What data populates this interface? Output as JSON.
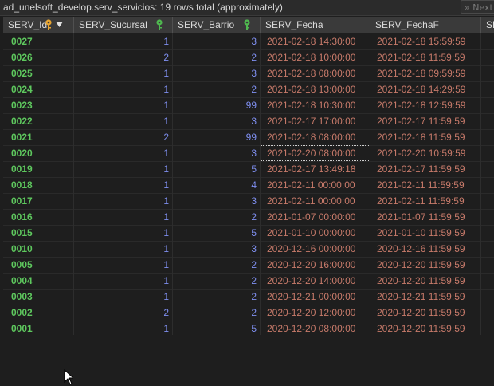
{
  "title": "ad_unelsoft_develop.serv_servicios: 19 rows total (approximately)",
  "next_button": "Next",
  "columns": [
    {
      "label": "SERV_Id"
    },
    {
      "label": "SERV_Sucursal"
    },
    {
      "label": "SERV_Barrio"
    },
    {
      "label": "SERV_Fecha"
    },
    {
      "label": "SERV_FechaF"
    },
    {
      "label": "SE"
    }
  ],
  "rows": [
    {
      "id": "0027",
      "suc": "1",
      "bar": "3",
      "fecha": "2021-02-18 14:30:00",
      "fechaf": "2021-02-18 15:59:59"
    },
    {
      "id": "0026",
      "suc": "2",
      "bar": "2",
      "fecha": "2021-02-18 10:00:00",
      "fechaf": "2021-02-18 11:59:59"
    },
    {
      "id": "0025",
      "suc": "1",
      "bar": "3",
      "fecha": "2021-02-18 08:00:00",
      "fechaf": "2021-02-18 09:59:59"
    },
    {
      "id": "0024",
      "suc": "1",
      "bar": "2",
      "fecha": "2021-02-18 13:00:00",
      "fechaf": "2021-02-18 14:29:59"
    },
    {
      "id": "0023",
      "suc": "1",
      "bar": "99",
      "fecha": "2021-02-18 10:30:00",
      "fechaf": "2021-02-18 12:59:59"
    },
    {
      "id": "0022",
      "suc": "1",
      "bar": "3",
      "fecha": "2021-02-17 17:00:00",
      "fechaf": "2021-02-17 11:59:59"
    },
    {
      "id": "0021",
      "suc": "2",
      "bar": "99",
      "fecha": "2021-02-18 08:00:00",
      "fechaf": "2021-02-18 11:59:59"
    },
    {
      "id": "0020",
      "suc": "1",
      "bar": "3",
      "fecha": "2021-02-20 08:00:00",
      "fechaf": "2021-02-20 10:59:59"
    },
    {
      "id": "0019",
      "suc": "1",
      "bar": "5",
      "fecha": "2021-02-17 13:49:18",
      "fechaf": "2021-02-17 11:59:59"
    },
    {
      "id": "0018",
      "suc": "1",
      "bar": "4",
      "fecha": "2021-02-11 00:00:00",
      "fechaf": "2021-02-11 11:59:59"
    },
    {
      "id": "0017",
      "suc": "1",
      "bar": "3",
      "fecha": "2021-02-11 00:00:00",
      "fechaf": "2021-02-11 11:59:59"
    },
    {
      "id": "0016",
      "suc": "1",
      "bar": "2",
      "fecha": "2021-01-07 00:00:00",
      "fechaf": "2021-01-07 11:59:59"
    },
    {
      "id": "0015",
      "suc": "1",
      "bar": "5",
      "fecha": "2021-01-10 00:00:00",
      "fechaf": "2021-01-10 11:59:59"
    },
    {
      "id": "0010",
      "suc": "1",
      "bar": "3",
      "fecha": "2020-12-16 00:00:00",
      "fechaf": "2020-12-16 11:59:59"
    },
    {
      "id": "0005",
      "suc": "1",
      "bar": "2",
      "fecha": "2020-12-20 16:00:00",
      "fechaf": "2020-12-20 11:59:59"
    },
    {
      "id": "0004",
      "suc": "1",
      "bar": "2",
      "fecha": "2020-12-20 14:00:00",
      "fechaf": "2020-12-20 11:59:59"
    },
    {
      "id": "0003",
      "suc": "1",
      "bar": "2",
      "fecha": "2020-12-21 00:00:00",
      "fechaf": "2020-12-21 11:59:59"
    },
    {
      "id": "0002",
      "suc": "2",
      "bar": "2",
      "fecha": "2020-12-20 12:00:00",
      "fechaf": "2020-12-20 11:59:59"
    },
    {
      "id": "0001",
      "suc": "1",
      "bar": "5",
      "fecha": "2020-12-20 08:00:00",
      "fechaf": "2020-12-20 11:59:59"
    }
  ],
  "selected_row": 7,
  "selected_column": "SERV_Fecha",
  "icons": {
    "primary_key": "key-icon-orange",
    "foreign_key": "key-icon-green",
    "sort": "sort-desc-icon"
  },
  "colors": {
    "id": "#5ec85e",
    "number": "#7f8ff0",
    "date": "#c77a6a",
    "header_bg": "#3a3a3a",
    "background": "#1e1e1e"
  }
}
